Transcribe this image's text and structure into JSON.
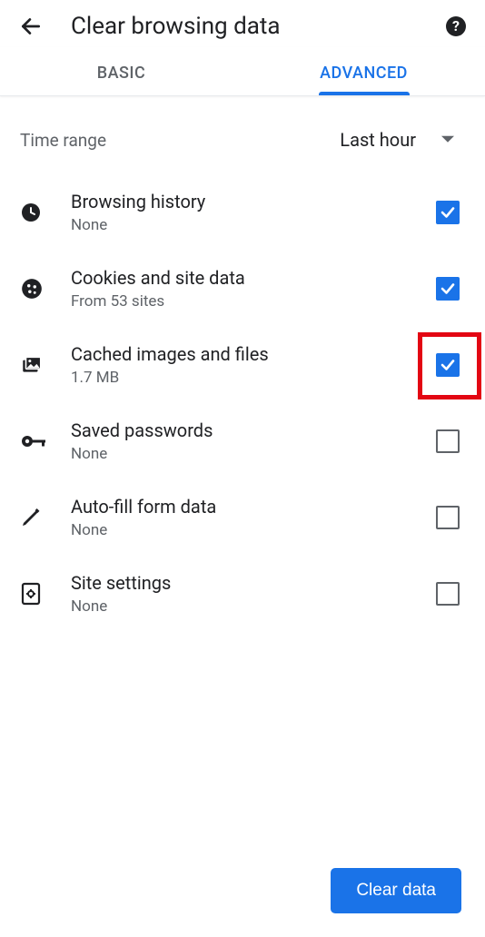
{
  "header": {
    "title": "Clear browsing data"
  },
  "tabs": {
    "basic": "BASIC",
    "advanced": "ADVANCED",
    "active": "advanced"
  },
  "timerange": {
    "label": "Time range",
    "value": "Last hour"
  },
  "items": [
    {
      "id": "browsing-history",
      "icon": "clock-icon",
      "title": "Browsing history",
      "subtitle": "None",
      "checked": true
    },
    {
      "id": "cookies",
      "icon": "cookie-icon",
      "title": "Cookies and site data",
      "subtitle": "From 53 sites",
      "checked": true
    },
    {
      "id": "cache",
      "icon": "image-stack-icon",
      "title": "Cached images and files",
      "subtitle": "1.7 MB",
      "checked": true,
      "highlighted": true
    },
    {
      "id": "passwords",
      "icon": "key-icon",
      "title": "Saved passwords",
      "subtitle": "None",
      "checked": false
    },
    {
      "id": "autofill",
      "icon": "pencil-icon",
      "title": "Auto-fill form data",
      "subtitle": "None",
      "checked": false
    },
    {
      "id": "site-settings",
      "icon": "settings-card-icon",
      "title": "Site settings",
      "subtitle": "None",
      "checked": false
    }
  ],
  "footer": {
    "clear": "Clear data"
  }
}
